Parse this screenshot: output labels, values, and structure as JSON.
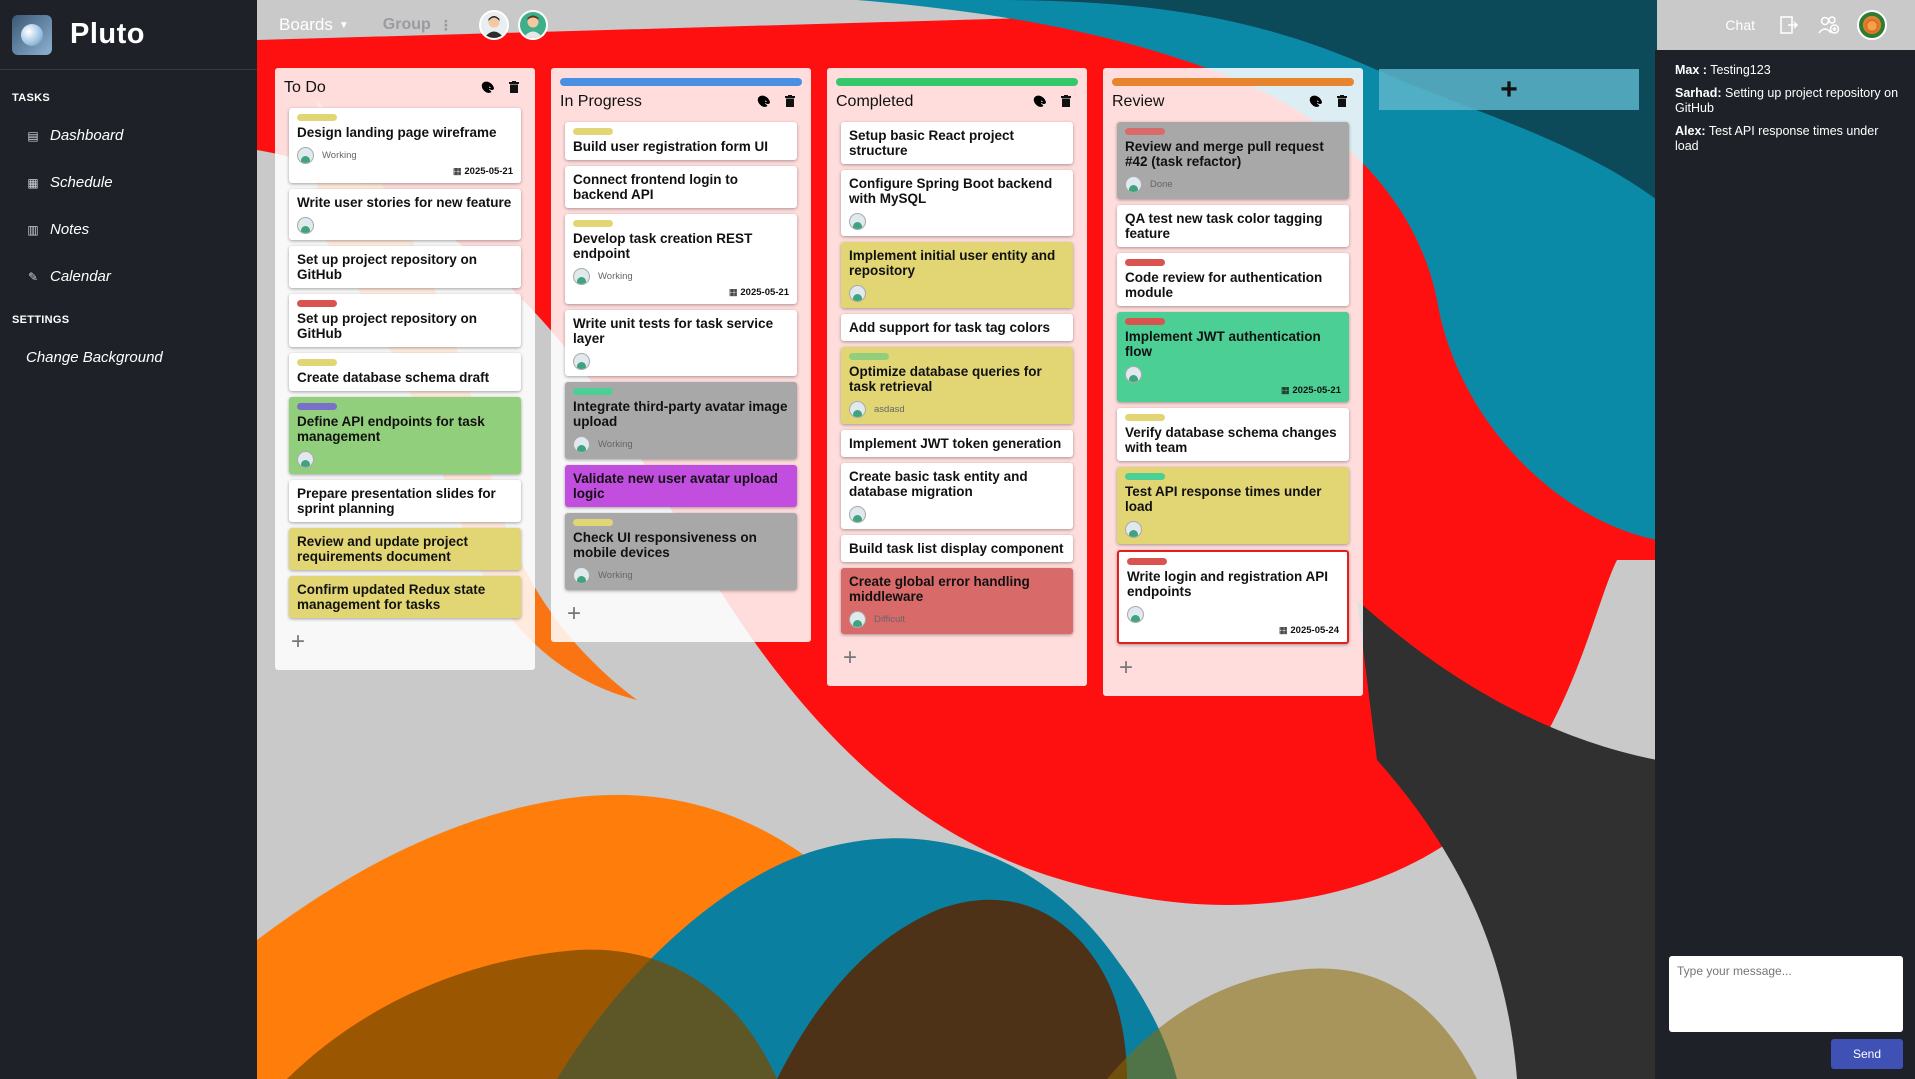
{
  "app": {
    "name": "Pluto"
  },
  "sidebar": {
    "tasks_heading": "TASKS",
    "items": [
      {
        "label": "Dashboard",
        "icon": "dashboard-icon"
      },
      {
        "label": "Schedule",
        "icon": "schedule-icon"
      },
      {
        "label": "Notes",
        "icon": "notes-icon"
      },
      {
        "label": "Calendar",
        "icon": "calendar-icon"
      }
    ],
    "settings_heading": "SETTINGS",
    "settings_items": [
      {
        "label": "Change Background"
      }
    ]
  },
  "topbar": {
    "boards_label": "Boards",
    "group_label": "Group",
    "chat_label": "Chat"
  },
  "columns": [
    {
      "title": "To Do",
      "bar_color": "",
      "cards": [
        {
          "title": "Design landing page wireframe",
          "tag": "#e2d674",
          "bg": "",
          "avatar": true,
          "status": "Working",
          "due": "2025-05-21"
        },
        {
          "title": "Write user stories for new feature",
          "tag": "",
          "bg": "",
          "avatar": true,
          "status": "",
          "due": ""
        },
        {
          "title": "Set up project repository on GitHub",
          "tag": "",
          "bg": "",
          "avatar": false,
          "status": "",
          "due": ""
        },
        {
          "title": "Set up project repository on GitHub",
          "tag": "#d9534f",
          "bg": "",
          "avatar": false,
          "status": "",
          "due": ""
        },
        {
          "title": "Create database schema draft",
          "tag": "#e2d674",
          "bg": "",
          "avatar": false,
          "status": "",
          "due": ""
        },
        {
          "title": "Define API endpoints for task management",
          "tag": "#7a70c9",
          "bg": "#92cf7c",
          "avatar": true,
          "status": "",
          "due": ""
        },
        {
          "title": "Prepare presentation slides for sprint planning",
          "tag": "",
          "bg": "",
          "avatar": false,
          "status": "",
          "due": ""
        },
        {
          "title": "Review and update project requirements document",
          "tag": "",
          "bg": "#e2d674",
          "avatar": false,
          "status": "",
          "due": ""
        },
        {
          "title": "Confirm updated Redux state management for tasks",
          "tag": "",
          "bg": "#e2d674",
          "avatar": false,
          "status": "",
          "due": ""
        }
      ]
    },
    {
      "title": "In Progress",
      "bar_color": "#4a90e2",
      "cards": [
        {
          "title": "Build user registration form UI",
          "tag": "#e2d674",
          "bg": "",
          "avatar": false,
          "status": "",
          "due": ""
        },
        {
          "title": "Connect frontend login to backend API",
          "tag": "",
          "bg": "",
          "avatar": false,
          "status": "",
          "due": ""
        },
        {
          "title": "Develop task creation REST endpoint",
          "tag": "#e2d674",
          "bg": "",
          "avatar": true,
          "status": "Working",
          "due": "2025-05-21"
        },
        {
          "title": "Write unit tests for task service layer",
          "tag": "",
          "bg": "",
          "avatar": true,
          "status": "",
          "due": ""
        },
        {
          "title": "Integrate third-party avatar image upload",
          "tag": "#4ccf94",
          "bg": "#a8a8a8",
          "avatar": true,
          "status": "Working",
          "due": ""
        },
        {
          "title": "Validate new user avatar upload logic",
          "tag": "",
          "bg": "#c24ee0",
          "avatar": false,
          "status": "",
          "due": ""
        },
        {
          "title": "Check UI responsiveness on mobile devices",
          "tag": "#e2d674",
          "bg": "#a8a8a8",
          "avatar": true,
          "status": "Working",
          "due": ""
        }
      ]
    },
    {
      "title": "Completed",
      "bar_color": "#34c76b",
      "cards": [
        {
          "title": "Setup basic React project structure",
          "tag": "",
          "bg": "",
          "avatar": false,
          "status": "",
          "due": ""
        },
        {
          "title": "Configure Spring Boot backend with MySQL",
          "tag": "",
          "bg": "",
          "avatar": true,
          "status": "",
          "due": ""
        },
        {
          "title": "Implement initial user entity and repository",
          "tag": "",
          "bg": "#e2d674",
          "avatar": true,
          "status": "",
          "due": ""
        },
        {
          "title": "Add support for task tag colors",
          "tag": "",
          "bg": "",
          "avatar": false,
          "status": "",
          "due": ""
        },
        {
          "title": "Optimize database queries for task retrieval",
          "tag": "#92cf7c",
          "bg": "#e2d674",
          "avatar": true,
          "status": "asdasd",
          "due": ""
        },
        {
          "title": "Implement JWT token generation",
          "tag": "",
          "bg": "",
          "avatar": false,
          "status": "",
          "due": ""
        },
        {
          "title": "Create basic task entity and database migration",
          "tag": "",
          "bg": "",
          "avatar": true,
          "status": "",
          "due": ""
        },
        {
          "title": "Build task list display component",
          "tag": "",
          "bg": "",
          "avatar": false,
          "status": "",
          "due": ""
        },
        {
          "title": "Create global error handling middleware",
          "tag": "",
          "bg": "#d96a6a",
          "avatar": true,
          "status": "Difficult",
          "due": ""
        }
      ]
    },
    {
      "title": "Review",
      "bar_color": "#e8842e",
      "cards": [
        {
          "title": "Review and merge pull request #42 (task refactor)",
          "tag": "#d96a6a",
          "bg": "#a8a8a8",
          "avatar": true,
          "status": "Done",
          "due": ""
        },
        {
          "title": "QA test new task color tagging feature",
          "tag": "",
          "bg": "",
          "avatar": false,
          "status": "",
          "due": ""
        },
        {
          "title": "Code review for authentication module",
          "tag": "#d9534f",
          "bg": "",
          "avatar": false,
          "status": "",
          "due": ""
        },
        {
          "title": "Implement JWT authentication flow",
          "tag": "#d9534f",
          "bg": "#4ccf94",
          "avatar": true,
          "status": "",
          "due": "2025-05-21"
        },
        {
          "title": "Verify database schema changes with team",
          "tag": "#e2d674",
          "bg": "",
          "avatar": false,
          "status": "",
          "due": ""
        },
        {
          "title": "Test API response times under load",
          "tag": "#4ccf94",
          "bg": "#e2d674",
          "avatar": true,
          "status": "",
          "due": ""
        },
        {
          "title": "Write login and registration API endpoints",
          "tag": "#d9534f",
          "bg": "",
          "avatar": true,
          "status": "",
          "due": "2025-05-24",
          "highlight": true
        }
      ]
    }
  ],
  "add_column_label": "+",
  "add_card_label": "+",
  "chat": {
    "messages": [
      {
        "author": "Max :",
        "text": "Testing123"
      },
      {
        "author": "Sarhad:",
        "text": "Setting up project repository on GitHub"
      },
      {
        "author": "Alex:",
        "text": "Test API response times under load"
      }
    ],
    "input_placeholder": "Type your message...",
    "send_label": "Send"
  }
}
